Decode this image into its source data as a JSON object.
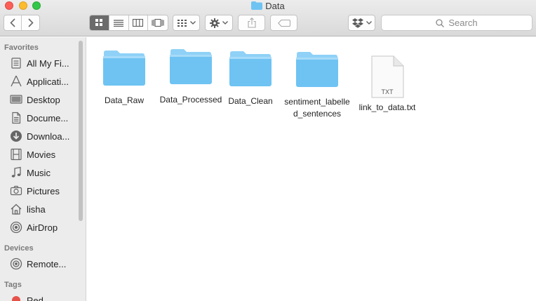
{
  "window": {
    "title": "Data"
  },
  "toolbar": {
    "back_label": "<",
    "forward_label": ">",
    "search_placeholder": "Search"
  },
  "sidebar": {
    "favorites_header": "Favorites",
    "favorites": [
      {
        "label": "All My Fi...",
        "icon": "all-files-icon"
      },
      {
        "label": "Applicati...",
        "icon": "applications-icon"
      },
      {
        "label": "Desktop",
        "icon": "desktop-icon"
      },
      {
        "label": "Docume...",
        "icon": "documents-icon"
      },
      {
        "label": "Downloa...",
        "icon": "downloads-icon"
      },
      {
        "label": "Movies",
        "icon": "movies-icon"
      },
      {
        "label": "Music",
        "icon": "music-icon"
      },
      {
        "label": "Pictures",
        "icon": "pictures-icon"
      },
      {
        "label": "lisha",
        "icon": "home-icon"
      },
      {
        "label": "AirDrop",
        "icon": "airdrop-icon"
      }
    ],
    "devices_header": "Devices",
    "devices": [
      {
        "label": "Remote...",
        "icon": "disc-icon"
      }
    ],
    "tags_header": "Tags",
    "tags": [
      {
        "label": "Red",
        "color": "#e5524a"
      }
    ]
  },
  "files": [
    {
      "name": "Data_Raw",
      "kind": "folder"
    },
    {
      "name": "Data_Processed",
      "kind": "folder"
    },
    {
      "name": "Data_Clean",
      "kind": "folder"
    },
    {
      "name_line1": "sentiment_labelle",
      "name_line2": "d_sentences",
      "kind": "folder"
    },
    {
      "name": "link_to_data.txt",
      "kind": "txt",
      "badge": "TXT"
    }
  ],
  "colors": {
    "folder": "#6ec3f3",
    "folder_tab": "#8fd1f7",
    "accent": "#6b6b6b"
  }
}
